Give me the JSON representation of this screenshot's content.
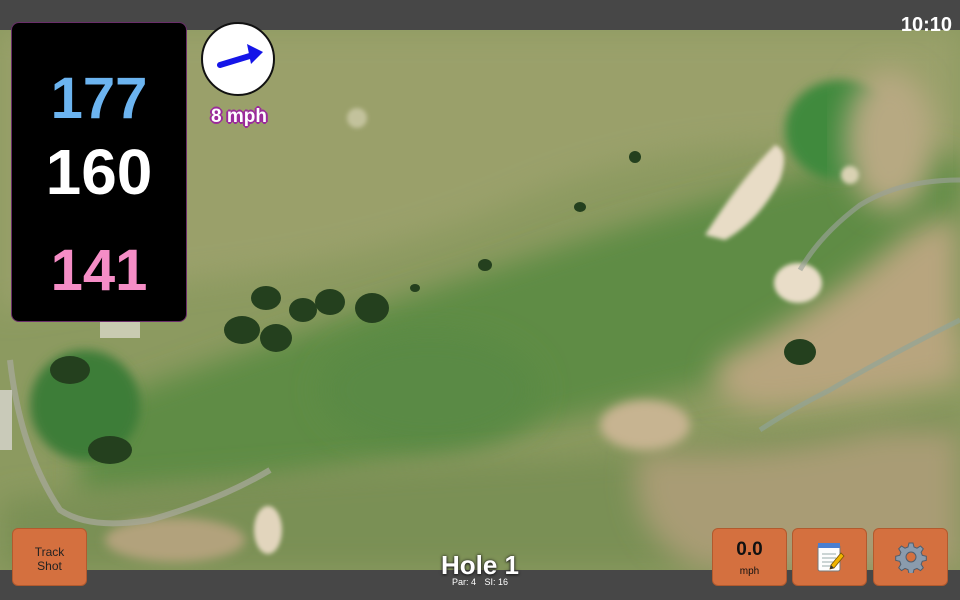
{
  "status_bar": {
    "time": "10:10"
  },
  "distances": {
    "back": "177",
    "middle": "160",
    "front": "141",
    "colors": {
      "back": "#6cb4f0",
      "middle": "#ffffff",
      "front": "#f58dc6"
    }
  },
  "wind": {
    "speed_label": "8 mph",
    "direction_icon": "wind-arrow-icon",
    "arrow_color": "#1515e8"
  },
  "track_shot_button": {
    "label_line1": "Track",
    "label_line2": "Shot"
  },
  "speed_button": {
    "value": "0.0",
    "unit": "mph"
  },
  "notes_button": {
    "icon": "notepad-icon"
  },
  "settings_button": {
    "icon": "gear-icon"
  },
  "hole_info": {
    "title": "Hole 1",
    "par_label": "Par: 4",
    "si_label": "SI: 16"
  },
  "colors": {
    "button_bg": "#d4703f",
    "panel_bg": "#000000",
    "bar_bg": "#474747",
    "wind_label_outline": "#9b2a9b"
  }
}
